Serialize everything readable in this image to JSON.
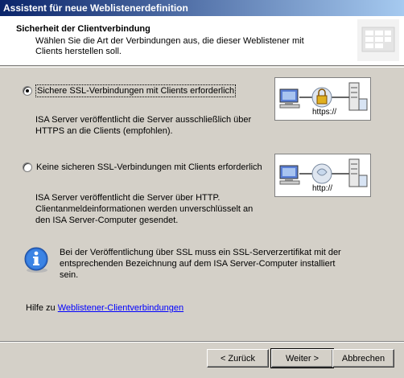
{
  "window": {
    "title": "Assistent für neue Weblistenerdefinition"
  },
  "header": {
    "title": "Sicherheit der Clientverbindung",
    "description": "Wählen Sie die Art der Verbindungen aus, die dieser Weblistener mit Clients herstellen soll.",
    "logo_icon": "wizard-graphic-icon"
  },
  "options": [
    {
      "label": "Sichere SSL-Verbindungen mit Clients erforderlich",
      "selected": true,
      "description": "ISA Server veröffentlicht die Server ausschließlich über HTTPS an die Clients (empfohlen).",
      "diagram_label": "https://"
    },
    {
      "label": "Keine sicheren SSL-Verbindungen mit Clients erforderlich",
      "selected": false,
      "description": "ISA Server veröffentlicht die Server über HTTP. Clientanmeldeinformationen werden unverschlüsselt an den ISA Server-Computer gesendet.",
      "diagram_label": "http://"
    }
  ],
  "info": {
    "icon": "info-icon",
    "text": "Bei der Veröffentlichung über SSL muss ein SSL-Serverzertifikat mit der entsprechenden Bezeichnung auf dem ISA Server-Computer installiert sein."
  },
  "help": {
    "prefix": "Hilfe zu ",
    "link": "Weblistener-Clientverbindungen"
  },
  "buttons": {
    "back": "< Zurück",
    "next": "Weiter >",
    "cancel": "Abbrechen"
  }
}
